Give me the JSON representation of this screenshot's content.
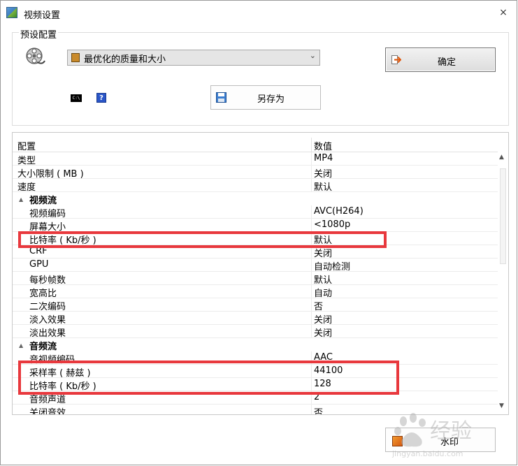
{
  "window": {
    "title": "视频设置",
    "close": "×"
  },
  "preset": {
    "group_label": "预设配置",
    "selected": "最优化的质量和大小",
    "ok_label": "确定",
    "save_as_label": "另存为",
    "cmd_label": "C:\\",
    "help_label": "?"
  },
  "table": {
    "headers": {
      "name": "配置",
      "value": "数值"
    },
    "rows": [
      {
        "name": "类型",
        "value": "MP4"
      },
      {
        "name": "大小限制 ( MB )",
        "value": "关闭"
      },
      {
        "name": "速度",
        "value": "默认"
      },
      {
        "name": "视频流",
        "value": "",
        "category": true
      },
      {
        "name": "视频编码",
        "value": "AVC(H264)"
      },
      {
        "name": "屏幕大小",
        "value": "<1080p"
      },
      {
        "name": "比特率 ( Kb/秒 )",
        "value": "默认"
      },
      {
        "name": "CRF",
        "value": "关闭"
      },
      {
        "name": "GPU",
        "value": "自动检测"
      },
      {
        "name": "每秒帧数",
        "value": "默认"
      },
      {
        "name": "宽高比",
        "value": "自动"
      },
      {
        "name": "二次编码",
        "value": "否"
      },
      {
        "name": "淡入效果",
        "value": "关闭"
      },
      {
        "name": "淡出效果",
        "value": "关闭"
      },
      {
        "name": "音频流",
        "value": "",
        "category": true
      },
      {
        "name": "音视频编码",
        "value": "AAC"
      },
      {
        "name": "采样率 ( 赫兹 )",
        "value": "44100"
      },
      {
        "name": "比特率 ( Kb/秒 )",
        "value": "128"
      },
      {
        "name": "音频声道",
        "value": "2"
      },
      {
        "name": "关闭音效",
        "value": "否"
      }
    ]
  },
  "watermark": {
    "label": "水印"
  },
  "colors": {
    "highlight": "#e8383d",
    "ok_border": "#707070"
  }
}
